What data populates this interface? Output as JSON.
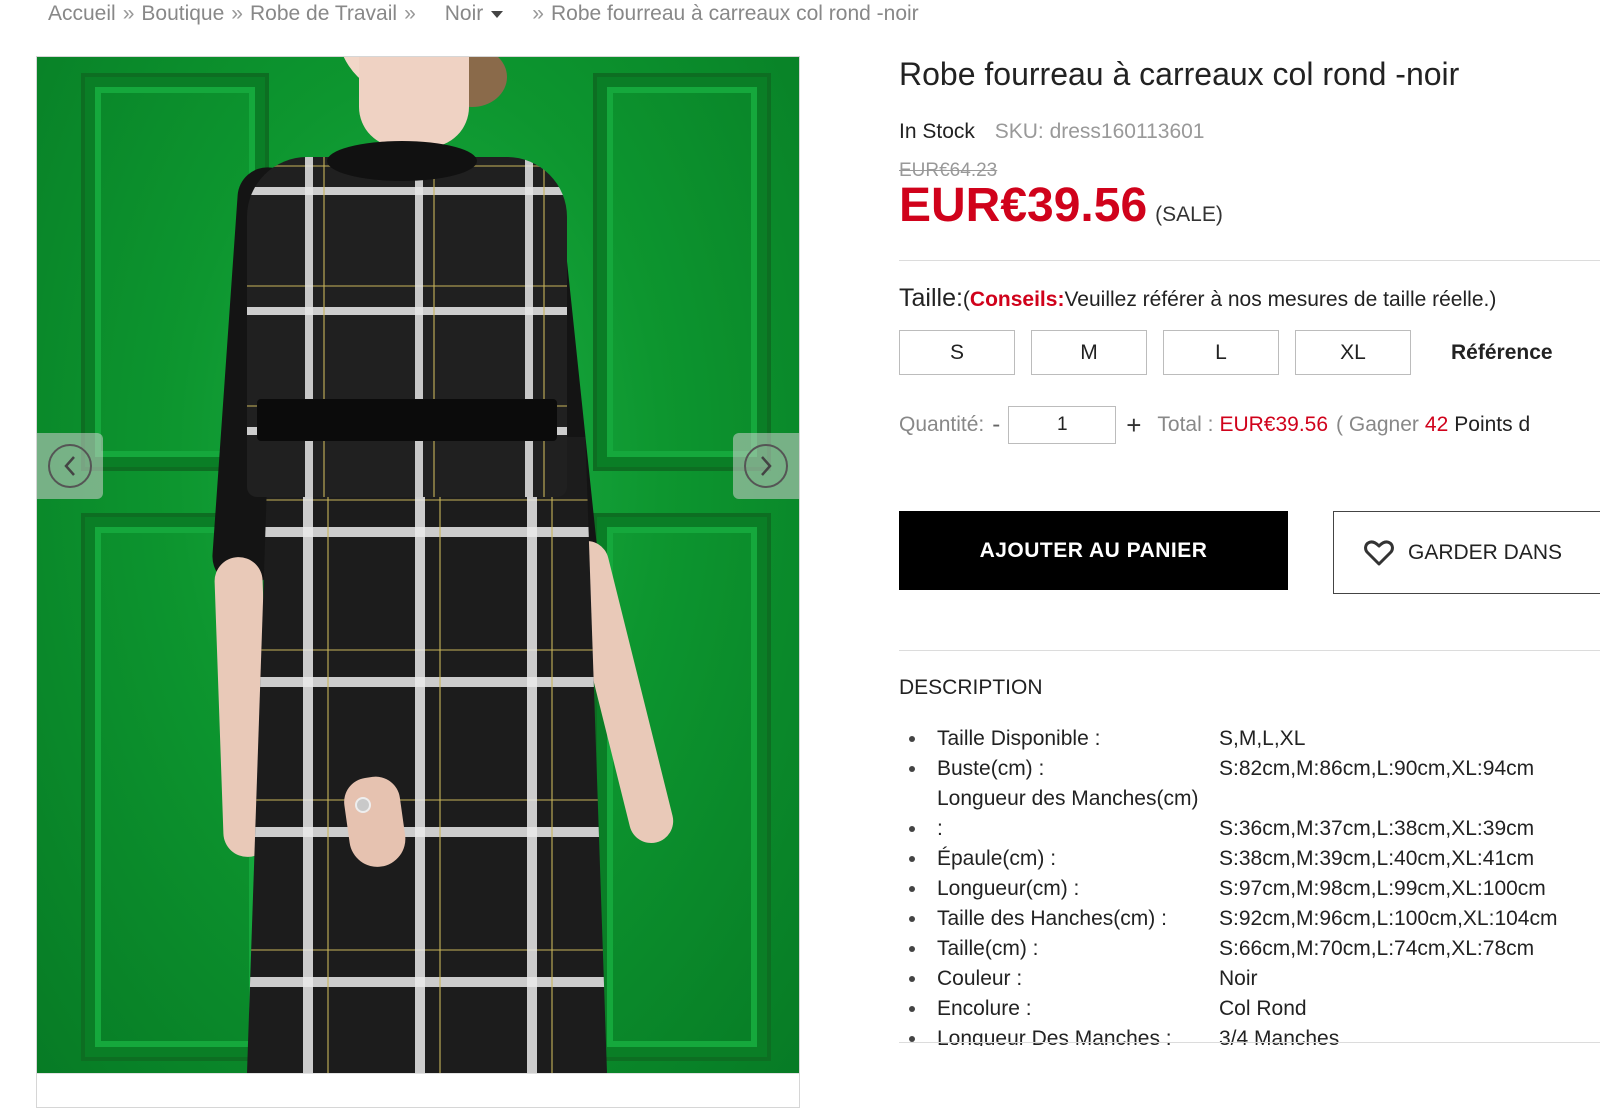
{
  "breadcrumb": {
    "home": "Accueil",
    "shop": "Boutique",
    "category": "Robe de Travail",
    "color_dropdown": "Noir",
    "current": "Robe fourreau à carreaux col rond -noir",
    "separator": "»"
  },
  "product": {
    "title": "Robe fourreau à carreaux col rond -noir",
    "stock": "In Stock",
    "sku_label": "SKU:",
    "sku": "dress160113601",
    "old_price": "EUR€64.23",
    "price": "EUR€39.56",
    "sale_tag": "(SALE)"
  },
  "size": {
    "label": "Taille:",
    "tips_open": "(",
    "tips_label": "Conseils:",
    "tips_text": "Veuillez référer à nos mesures de taille réelle.)",
    "options": [
      "S",
      "M",
      "L",
      "XL"
    ],
    "reference_link": "Référence"
  },
  "quantity": {
    "label": "Quantité:",
    "minus": "-",
    "value": "1",
    "plus": "+",
    "total_label": "Total :",
    "total_value": "EUR€39.56",
    "points_prefix": "( Gagner",
    "points": "42",
    "points_suffix": "Points d"
  },
  "actions": {
    "add_to_cart": "AJOUTER AU PANIER",
    "wishlist": "GARDER DANS",
    "wishlist_icon": "heart-icon"
  },
  "description": {
    "title": "DESCRIPTION",
    "rows": [
      {
        "label": "Taille Disponible :",
        "value": "S,M,L,XL"
      },
      {
        "label": "Buste(cm) :",
        "value": "S:82cm,M:86cm,L:90cm,XL:94cm"
      },
      {
        "label": "Longueur des Manches(cm)",
        "value": ""
      },
      {
        "label": ":",
        "value": "S:36cm,M:37cm,L:38cm,XL:39cm"
      },
      {
        "label": "Épaule(cm) :",
        "value": "S:38cm,M:39cm,L:40cm,XL:41cm"
      },
      {
        "label": "Longueur(cm) :",
        "value": "S:97cm,M:98cm,L:99cm,XL:100cm"
      },
      {
        "label": "Taille des Hanches(cm) :",
        "value": "S:92cm,M:96cm,L:100cm,XL:104cm"
      },
      {
        "label": "Taille(cm) :",
        "value": "S:66cm,M:70cm,L:74cm,XL:78cm"
      },
      {
        "label": "Couleur :",
        "value": "Noir"
      },
      {
        "label": "Encolure :",
        "value": "Col Rond"
      },
      {
        "label": "Longueur Des Manches :",
        "value": "3/4 Manches"
      }
    ]
  },
  "gallery": {
    "prev_icon": "chevron-left-icon",
    "next_icon": "chevron-right-icon"
  },
  "colors": {
    "price_red": "#d0021b",
    "button_black": "#000000",
    "background_green": "#0d962f"
  }
}
